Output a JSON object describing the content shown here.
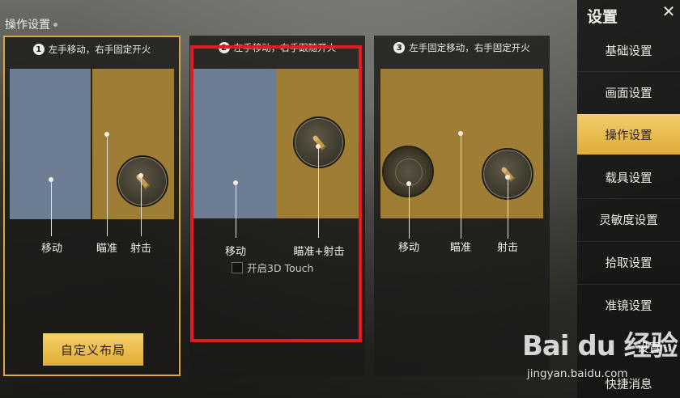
{
  "page_title": "操作设置",
  "sidebar": {
    "title": "设置",
    "close_icon": "close-icon",
    "items": [
      {
        "label": "基础设置",
        "active": false
      },
      {
        "label": "画面设置",
        "active": false
      },
      {
        "label": "操作设置",
        "active": true
      },
      {
        "label": "载具设置",
        "active": false
      },
      {
        "label": "灵敏度设置",
        "active": false
      },
      {
        "label": "拾取设置",
        "active": false
      },
      {
        "label": "准镜设置",
        "active": false
      },
      {
        "label": "设置",
        "active": false
      },
      {
        "label": "快捷消息",
        "active": false
      }
    ]
  },
  "options": [
    {
      "number": "1",
      "title": "左手移动，右手固定开火",
      "labels": {
        "move": "移动",
        "aim": "瞄准",
        "fire": "射击"
      },
      "selected": true,
      "custom_button": "自定义布局"
    },
    {
      "number": "2",
      "title": "左手移动，右手跟随开火",
      "labels": {
        "move": "移动",
        "aim_fire": "瞄准+射击"
      },
      "selected": false,
      "touch_checkbox": {
        "label": "开启3D Touch",
        "checked": false
      }
    },
    {
      "number": "3",
      "title": "左手固定移动，右手固定开火",
      "labels": {
        "move": "移动",
        "aim": "瞄准",
        "fire": "射击"
      },
      "selected": false
    }
  ],
  "watermark": {
    "text": "Bai du 经验",
    "url": "jingyan.baidu.com"
  },
  "colors": {
    "accent": "#e2ad35",
    "highlight_box": "#e21b24",
    "move_zone": "#6d7d94",
    "aim_zone": "#9f7d35"
  }
}
